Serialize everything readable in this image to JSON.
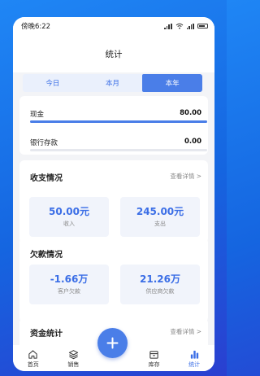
{
  "status_bar": {
    "time": "傍晚6:22",
    "battery_icon": "battery-icon",
    "wifi_icon": "wifi-icon",
    "signal_icon": "signal-icon"
  },
  "header": {
    "title": "统计"
  },
  "tabs": [
    {
      "label": "今日",
      "active": false
    },
    {
      "label": "本月",
      "active": false
    },
    {
      "label": "本年",
      "active": true
    }
  ],
  "accounts": [
    {
      "label": "现金",
      "value": "80.00",
      "fill": 1.0
    },
    {
      "label": "银行存款",
      "value": "0.00",
      "fill": 0.0
    }
  ],
  "income_expense": {
    "title": "收支情况",
    "link": "查看详情 >",
    "income": {
      "value": "50.00元",
      "label": "收入"
    },
    "expense": {
      "value": "245.00元",
      "label": "支出"
    }
  },
  "debt": {
    "title": "欠款情况",
    "customer": {
      "value": "-1.66万",
      "label": "客户欠款"
    },
    "supplier": {
      "value": "21.26万",
      "label": "供应商欠款"
    }
  },
  "funds": {
    "title": "资金统计",
    "link": "查看详情 >"
  },
  "tabbar": [
    {
      "label": "首页",
      "icon": "home-icon",
      "active": false
    },
    {
      "label": "销售",
      "icon": "layers-icon",
      "active": false
    },
    {
      "label": "库存",
      "icon": "box-icon",
      "active": false
    },
    {
      "label": "统计",
      "icon": "bar-chart-icon",
      "active": true
    }
  ],
  "fab": {
    "icon": "plus-icon"
  },
  "colors": {
    "accent": "#4a7ee8",
    "background_gradient_start": "#1f86f5",
    "background_gradient_end": "#2a3fd0"
  }
}
